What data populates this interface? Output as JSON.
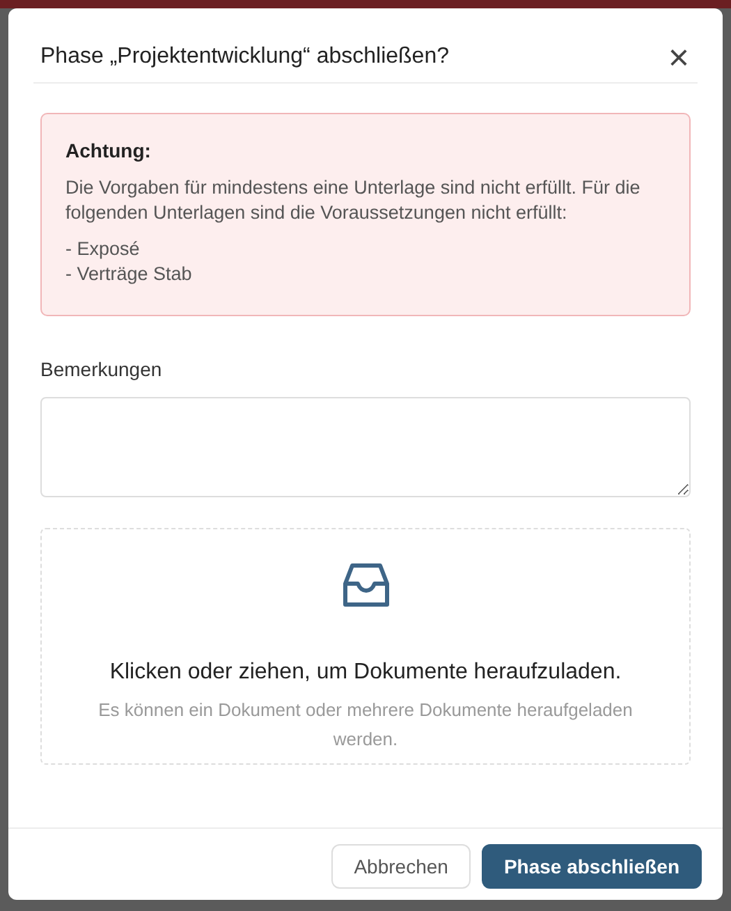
{
  "dialog": {
    "title": "Phase „Projektentwicklung“ abschließen?",
    "close_label": "×"
  },
  "alert": {
    "heading": "Achtung:",
    "message": "Die Vorgaben für mindestens eine Unterlage sind nicht erfüllt. Für die folgenden Unterlagen sind die Voraussetzungen nicht erfüllt:",
    "items": [
      "- Exposé",
      "- Verträge Stab"
    ]
  },
  "remarks": {
    "label": "Bemerkungen"
  },
  "upload": {
    "title": "Klicken oder ziehen, um Dokumente heraufzuladen.",
    "hint": "Es können ein Dokument oder mehrere Dokumente heraufgeladen werden."
  },
  "buttons": [
    {
      "label": "Abbrechen",
      "kind": "secondary"
    },
    {
      "label": "Phase abschließen",
      "kind": "primary"
    }
  ]
}
